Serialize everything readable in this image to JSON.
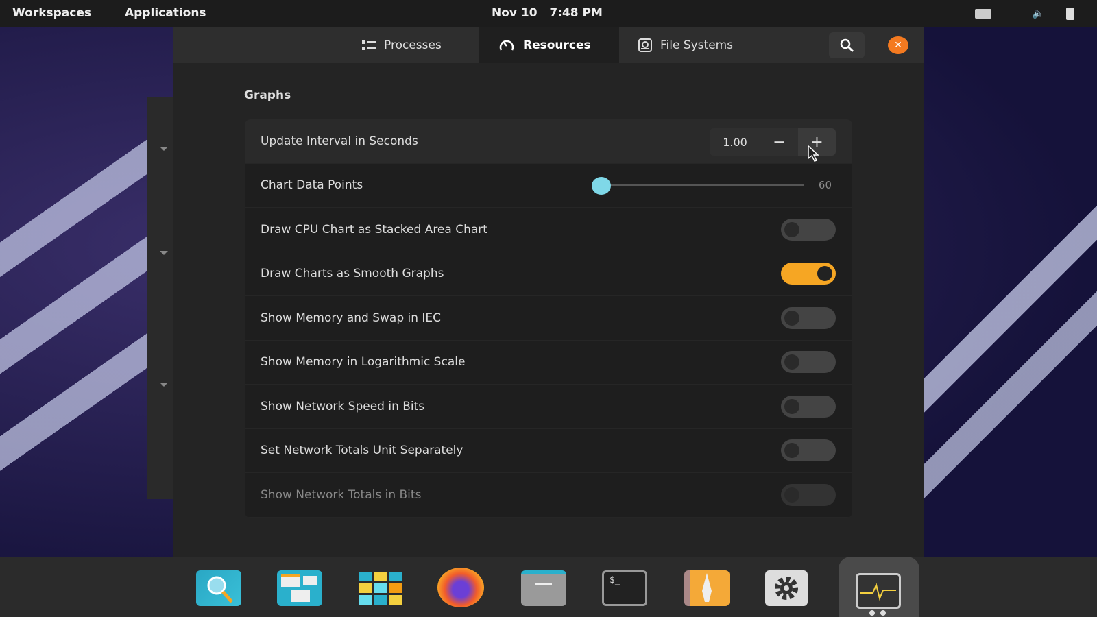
{
  "topbar": {
    "workspaces": "Workspaces",
    "applications": "Applications",
    "clock": "Nov 10   7:48 PM"
  },
  "tabs": [
    {
      "label": "Processes",
      "icon": "list-icon"
    },
    {
      "label": "Resources",
      "icon": "gauge-icon",
      "active": true
    },
    {
      "label": "File Systems",
      "icon": "disk-icon"
    }
  ],
  "section_title": "Graphs",
  "settings": {
    "update_interval": {
      "label": "Update Interval in Seconds",
      "value": "1.00",
      "minus": "−",
      "plus": "+"
    },
    "chart_points": {
      "label": "Chart Data Points",
      "value": "60",
      "fraction": 0
    },
    "toggles": [
      {
        "label": "Draw CPU Chart as Stacked Area Chart",
        "on": false
      },
      {
        "label": "Draw Charts as Smooth Graphs",
        "on": true
      },
      {
        "label": "Show Memory and Swap in IEC",
        "on": false
      },
      {
        "label": "Show Memory in Logarithmic Scale",
        "on": false
      },
      {
        "label": "Show Network Speed in Bits",
        "on": false
      },
      {
        "label": "Set Network Totals Unit Separately",
        "on": false
      },
      {
        "label": "Show Network Totals in Bits",
        "on": false,
        "disabled": true
      }
    ]
  },
  "close_symbol": "✕",
  "colors": {
    "accent": "#f6a623",
    "slider": "#7fd8e8",
    "close": "#f47a20"
  },
  "dock": [
    "search-app",
    "window-overview",
    "app-grid",
    "firefox",
    "files",
    "terminal",
    "software-center",
    "settings",
    "system-monitor"
  ]
}
